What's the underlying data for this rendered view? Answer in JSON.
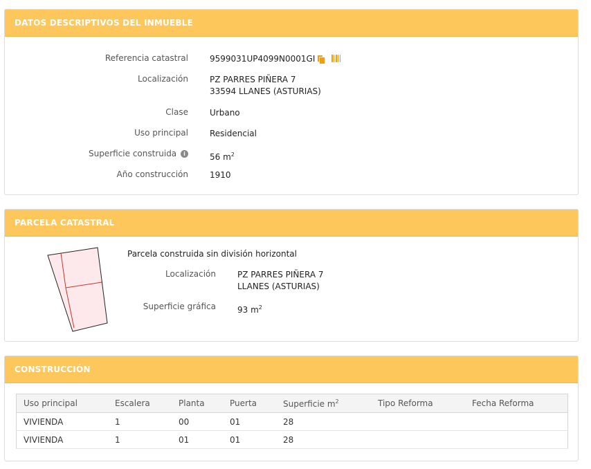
{
  "datos": {
    "title": "DATOS DESCRIPTIVOS DEL INMUEBLE",
    "ref_label": "Referencia catastral",
    "ref_value": "9599031UP4099N0001GI",
    "loc_label": "Localización",
    "loc_line1": "PZ PARRES PIÑERA 7",
    "loc_line2": "33594 LLANES (ASTURIAS)",
    "clase_label": "Clase",
    "clase_value": "Urbano",
    "uso_label": "Uso principal",
    "uso_value": "Residencial",
    "sup_label": "Superficie construida",
    "sup_value": "56 m",
    "sup_exp": "2",
    "anio_label": "Año construcción",
    "anio_value": "1910"
  },
  "parcela": {
    "title": "PARCELA CATASTRAL",
    "desc": "Parcela construida sin división horizontal",
    "loc_label": "Localización",
    "loc_line1": "PZ PARRES PIÑERA 7",
    "loc_line2": "LLANES (ASTURIAS)",
    "sup_label": "Superficie gráfica",
    "sup_value": "93 m",
    "sup_exp": "2"
  },
  "construccion": {
    "title": "CONSTRUCCIÓN",
    "headers": [
      "Uso principal",
      "Escalera",
      "Planta",
      "Puerta",
      "Superficie m",
      "Tipo Reforma",
      "Fecha Reforma"
    ],
    "header_exp": "2",
    "rows": [
      [
        "VIVIENDA",
        "1",
        "00",
        "01",
        "28",
        "",
        ""
      ],
      [
        "VIVIENDA",
        "1",
        "01",
        "01",
        "28",
        "",
        ""
      ]
    ]
  },
  "colors": {
    "header": "#fdc75c",
    "accent": "#f39c12",
    "parcel_fill": "#fde8ec",
    "parcel_line": "#c0392b"
  }
}
